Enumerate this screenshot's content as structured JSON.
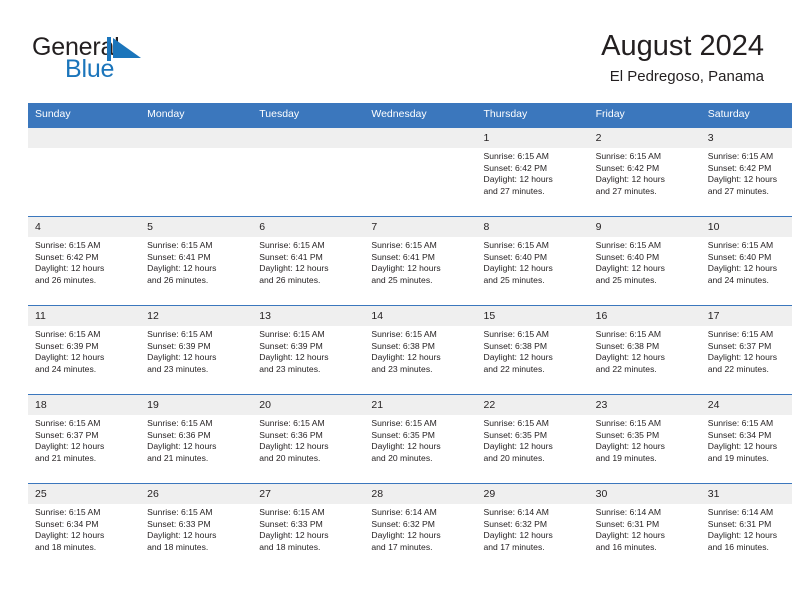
{
  "brand": {
    "name_part1": "General",
    "name_part2": "Blue",
    "mark_name": "triangle-flag-logo",
    "color_primary": "#1b75bb",
    "color_text": "#231f20"
  },
  "header": {
    "title": "August 2024",
    "subtitle": "El Pedregoso, Panama"
  },
  "theme": {
    "header_bg": "#3b77bd",
    "daynum_bg": "#efefef",
    "row_border": "#3b77bd",
    "text": "#231f20"
  },
  "calendar": {
    "weekday_headers": [
      "Sunday",
      "Monday",
      "Tuesday",
      "Wednesday",
      "Thursday",
      "Friday",
      "Saturday"
    ],
    "weeks": [
      [
        {
          "day": "",
          "empty": true,
          "sunrise": "",
          "sunset": "",
          "daylight_line1": "",
          "daylight_line2": ""
        },
        {
          "day": "",
          "empty": true,
          "sunrise": "",
          "sunset": "",
          "daylight_line1": "",
          "daylight_line2": ""
        },
        {
          "day": "",
          "empty": true,
          "sunrise": "",
          "sunset": "",
          "daylight_line1": "",
          "daylight_line2": ""
        },
        {
          "day": "",
          "empty": true,
          "sunrise": "",
          "sunset": "",
          "daylight_line1": "",
          "daylight_line2": ""
        },
        {
          "day": "1",
          "empty": false,
          "sunrise": "Sunrise: 6:15 AM",
          "sunset": "Sunset: 6:42 PM",
          "daylight_line1": "Daylight: 12 hours",
          "daylight_line2": "and 27 minutes."
        },
        {
          "day": "2",
          "empty": false,
          "sunrise": "Sunrise: 6:15 AM",
          "sunset": "Sunset: 6:42 PM",
          "daylight_line1": "Daylight: 12 hours",
          "daylight_line2": "and 27 minutes."
        },
        {
          "day": "3",
          "empty": false,
          "sunrise": "Sunrise: 6:15 AM",
          "sunset": "Sunset: 6:42 PM",
          "daylight_line1": "Daylight: 12 hours",
          "daylight_line2": "and 27 minutes."
        }
      ],
      [
        {
          "day": "4",
          "empty": false,
          "sunrise": "Sunrise: 6:15 AM",
          "sunset": "Sunset: 6:42 PM",
          "daylight_line1": "Daylight: 12 hours",
          "daylight_line2": "and 26 minutes."
        },
        {
          "day": "5",
          "empty": false,
          "sunrise": "Sunrise: 6:15 AM",
          "sunset": "Sunset: 6:41 PM",
          "daylight_line1": "Daylight: 12 hours",
          "daylight_line2": "and 26 minutes."
        },
        {
          "day": "6",
          "empty": false,
          "sunrise": "Sunrise: 6:15 AM",
          "sunset": "Sunset: 6:41 PM",
          "daylight_line1": "Daylight: 12 hours",
          "daylight_line2": "and 26 minutes."
        },
        {
          "day": "7",
          "empty": false,
          "sunrise": "Sunrise: 6:15 AM",
          "sunset": "Sunset: 6:41 PM",
          "daylight_line1": "Daylight: 12 hours",
          "daylight_line2": "and 25 minutes."
        },
        {
          "day": "8",
          "empty": false,
          "sunrise": "Sunrise: 6:15 AM",
          "sunset": "Sunset: 6:40 PM",
          "daylight_line1": "Daylight: 12 hours",
          "daylight_line2": "and 25 minutes."
        },
        {
          "day": "9",
          "empty": false,
          "sunrise": "Sunrise: 6:15 AM",
          "sunset": "Sunset: 6:40 PM",
          "daylight_line1": "Daylight: 12 hours",
          "daylight_line2": "and 25 minutes."
        },
        {
          "day": "10",
          "empty": false,
          "sunrise": "Sunrise: 6:15 AM",
          "sunset": "Sunset: 6:40 PM",
          "daylight_line1": "Daylight: 12 hours",
          "daylight_line2": "and 24 minutes."
        }
      ],
      [
        {
          "day": "11",
          "empty": false,
          "sunrise": "Sunrise: 6:15 AM",
          "sunset": "Sunset: 6:39 PM",
          "daylight_line1": "Daylight: 12 hours",
          "daylight_line2": "and 24 minutes."
        },
        {
          "day": "12",
          "empty": false,
          "sunrise": "Sunrise: 6:15 AM",
          "sunset": "Sunset: 6:39 PM",
          "daylight_line1": "Daylight: 12 hours",
          "daylight_line2": "and 23 minutes."
        },
        {
          "day": "13",
          "empty": false,
          "sunrise": "Sunrise: 6:15 AM",
          "sunset": "Sunset: 6:39 PM",
          "daylight_line1": "Daylight: 12 hours",
          "daylight_line2": "and 23 minutes."
        },
        {
          "day": "14",
          "empty": false,
          "sunrise": "Sunrise: 6:15 AM",
          "sunset": "Sunset: 6:38 PM",
          "daylight_line1": "Daylight: 12 hours",
          "daylight_line2": "and 23 minutes."
        },
        {
          "day": "15",
          "empty": false,
          "sunrise": "Sunrise: 6:15 AM",
          "sunset": "Sunset: 6:38 PM",
          "daylight_line1": "Daylight: 12 hours",
          "daylight_line2": "and 22 minutes."
        },
        {
          "day": "16",
          "empty": false,
          "sunrise": "Sunrise: 6:15 AM",
          "sunset": "Sunset: 6:38 PM",
          "daylight_line1": "Daylight: 12 hours",
          "daylight_line2": "and 22 minutes."
        },
        {
          "day": "17",
          "empty": false,
          "sunrise": "Sunrise: 6:15 AM",
          "sunset": "Sunset: 6:37 PM",
          "daylight_line1": "Daylight: 12 hours",
          "daylight_line2": "and 22 minutes."
        }
      ],
      [
        {
          "day": "18",
          "empty": false,
          "sunrise": "Sunrise: 6:15 AM",
          "sunset": "Sunset: 6:37 PM",
          "daylight_line1": "Daylight: 12 hours",
          "daylight_line2": "and 21 minutes."
        },
        {
          "day": "19",
          "empty": false,
          "sunrise": "Sunrise: 6:15 AM",
          "sunset": "Sunset: 6:36 PM",
          "daylight_line1": "Daylight: 12 hours",
          "daylight_line2": "and 21 minutes."
        },
        {
          "day": "20",
          "empty": false,
          "sunrise": "Sunrise: 6:15 AM",
          "sunset": "Sunset: 6:36 PM",
          "daylight_line1": "Daylight: 12 hours",
          "daylight_line2": "and 20 minutes."
        },
        {
          "day": "21",
          "empty": false,
          "sunrise": "Sunrise: 6:15 AM",
          "sunset": "Sunset: 6:35 PM",
          "daylight_line1": "Daylight: 12 hours",
          "daylight_line2": "and 20 minutes."
        },
        {
          "day": "22",
          "empty": false,
          "sunrise": "Sunrise: 6:15 AM",
          "sunset": "Sunset: 6:35 PM",
          "daylight_line1": "Daylight: 12 hours",
          "daylight_line2": "and 20 minutes."
        },
        {
          "day": "23",
          "empty": false,
          "sunrise": "Sunrise: 6:15 AM",
          "sunset": "Sunset: 6:35 PM",
          "daylight_line1": "Daylight: 12 hours",
          "daylight_line2": "and 19 minutes."
        },
        {
          "day": "24",
          "empty": false,
          "sunrise": "Sunrise: 6:15 AM",
          "sunset": "Sunset: 6:34 PM",
          "daylight_line1": "Daylight: 12 hours",
          "daylight_line2": "and 19 minutes."
        }
      ],
      [
        {
          "day": "25",
          "empty": false,
          "sunrise": "Sunrise: 6:15 AM",
          "sunset": "Sunset: 6:34 PM",
          "daylight_line1": "Daylight: 12 hours",
          "daylight_line2": "and 18 minutes."
        },
        {
          "day": "26",
          "empty": false,
          "sunrise": "Sunrise: 6:15 AM",
          "sunset": "Sunset: 6:33 PM",
          "daylight_line1": "Daylight: 12 hours",
          "daylight_line2": "and 18 minutes."
        },
        {
          "day": "27",
          "empty": false,
          "sunrise": "Sunrise: 6:15 AM",
          "sunset": "Sunset: 6:33 PM",
          "daylight_line1": "Daylight: 12 hours",
          "daylight_line2": "and 18 minutes."
        },
        {
          "day": "28",
          "empty": false,
          "sunrise": "Sunrise: 6:14 AM",
          "sunset": "Sunset: 6:32 PM",
          "daylight_line1": "Daylight: 12 hours",
          "daylight_line2": "and 17 minutes."
        },
        {
          "day": "29",
          "empty": false,
          "sunrise": "Sunrise: 6:14 AM",
          "sunset": "Sunset: 6:32 PM",
          "daylight_line1": "Daylight: 12 hours",
          "daylight_line2": "and 17 minutes."
        },
        {
          "day": "30",
          "empty": false,
          "sunrise": "Sunrise: 6:14 AM",
          "sunset": "Sunset: 6:31 PM",
          "daylight_line1": "Daylight: 12 hours",
          "daylight_line2": "and 16 minutes."
        },
        {
          "day": "31",
          "empty": false,
          "sunrise": "Sunrise: 6:14 AM",
          "sunset": "Sunset: 6:31 PM",
          "daylight_line1": "Daylight: 12 hours",
          "daylight_line2": "and 16 minutes."
        }
      ]
    ]
  }
}
